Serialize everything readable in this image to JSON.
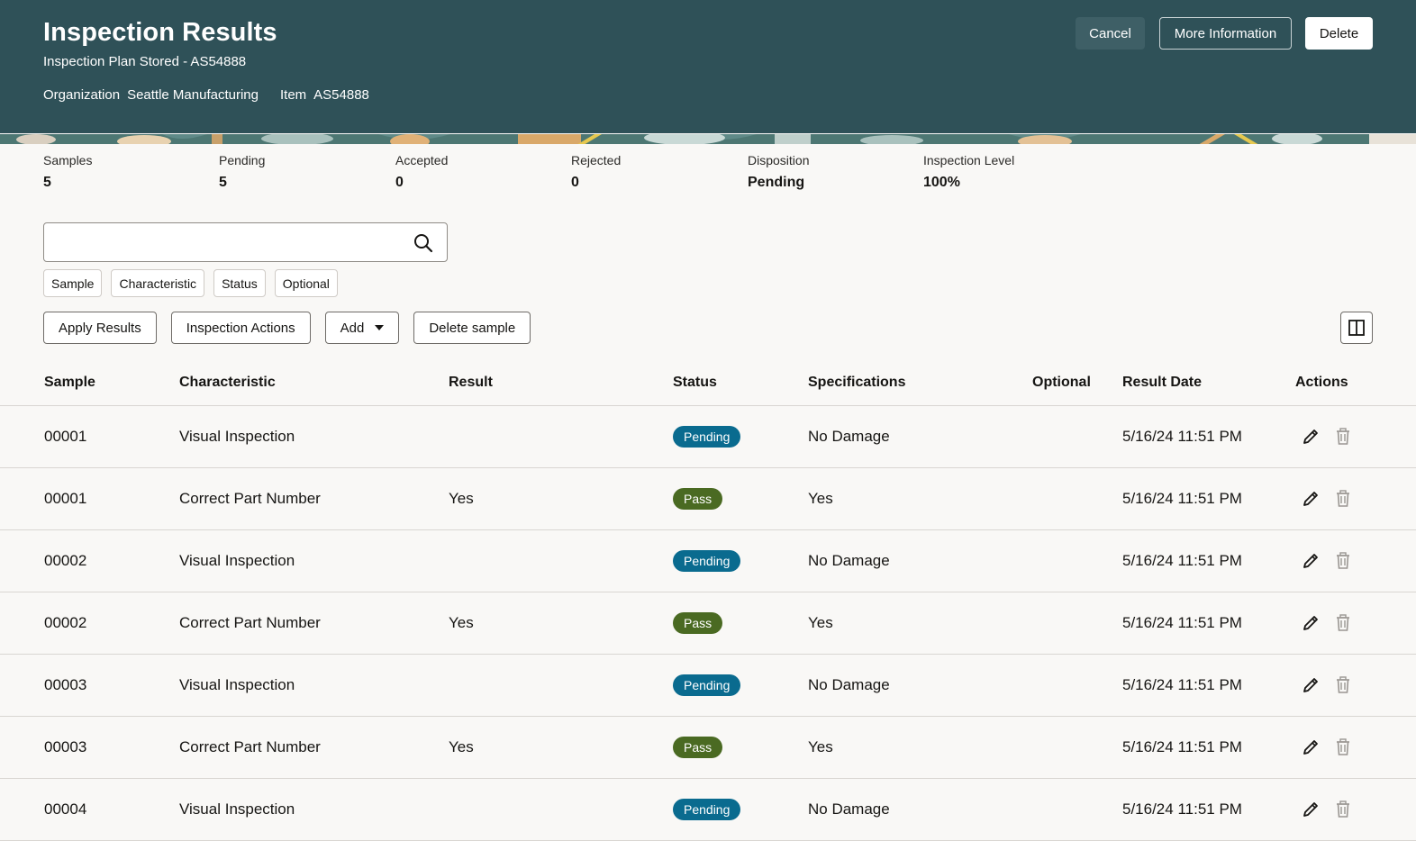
{
  "header": {
    "title": "Inspection Results",
    "subtitle": "Inspection Plan Stored - AS54888",
    "meta": [
      {
        "label": "Organization",
        "value": "Seattle Manufacturing"
      },
      {
        "label": "Item",
        "value": "AS54888"
      }
    ],
    "buttons": {
      "cancel": "Cancel",
      "more_info": "More Information",
      "delete": "Delete"
    }
  },
  "summary": [
    {
      "label": "Samples",
      "value": "5"
    },
    {
      "label": "Pending",
      "value": "5"
    },
    {
      "label": "Accepted",
      "value": "0"
    },
    {
      "label": "Rejected",
      "value": "0"
    },
    {
      "label": "Disposition",
      "value": "Pending"
    },
    {
      "label": "Inspection Level",
      "value": "100%"
    }
  ],
  "search": {
    "placeholder": "",
    "value": ""
  },
  "filters": [
    "Sample",
    "Characteristic",
    "Status",
    "Optional"
  ],
  "toolbar": {
    "apply_results": "Apply Results",
    "inspection_actions": "Inspection Actions",
    "add": "Add",
    "delete_sample": "Delete sample"
  },
  "table": {
    "columns": [
      "Sample",
      "Characteristic",
      "Result",
      "Status",
      "Specifications",
      "Optional",
      "Result Date",
      "Actions"
    ],
    "rows": [
      {
        "sample": "00001",
        "characteristic": "Visual Inspection",
        "result": "",
        "status": "Pending",
        "spec": "No Damage",
        "optional": "",
        "date": "5/16/24 11:51 PM"
      },
      {
        "sample": "00001",
        "characteristic": "Correct Part Number",
        "result": "Yes",
        "status": "Pass",
        "spec": "Yes",
        "optional": "",
        "date": "5/16/24 11:51 PM"
      },
      {
        "sample": "00002",
        "characteristic": "Visual Inspection",
        "result": "",
        "status": "Pending",
        "spec": "No Damage",
        "optional": "",
        "date": "5/16/24 11:51 PM"
      },
      {
        "sample": "00002",
        "characteristic": "Correct Part Number",
        "result": "Yes",
        "status": "Pass",
        "spec": "Yes",
        "optional": "",
        "date": "5/16/24 11:51 PM"
      },
      {
        "sample": "00003",
        "characteristic": "Visual Inspection",
        "result": "",
        "status": "Pending",
        "spec": "No Damage",
        "optional": "",
        "date": "5/16/24 11:51 PM"
      },
      {
        "sample": "00003",
        "characteristic": "Correct Part Number",
        "result": "Yes",
        "status": "Pass",
        "spec": "Yes",
        "optional": "",
        "date": "5/16/24 11:51 PM"
      },
      {
        "sample": "00004",
        "characteristic": "Visual Inspection",
        "result": "",
        "status": "Pending",
        "spec": "No Damage",
        "optional": "",
        "date": "5/16/24 11:51 PM"
      }
    ]
  },
  "icons": {
    "search": "search-icon",
    "columns": "columns-icon",
    "edit": "pencil-icon",
    "delete": "trash-icon",
    "dropdown": "caret-down-icon"
  },
  "colors": {
    "header_bg": "#2f5158",
    "pending_badge": "#0a6b8f",
    "pass_badge": "#4a6a22"
  }
}
